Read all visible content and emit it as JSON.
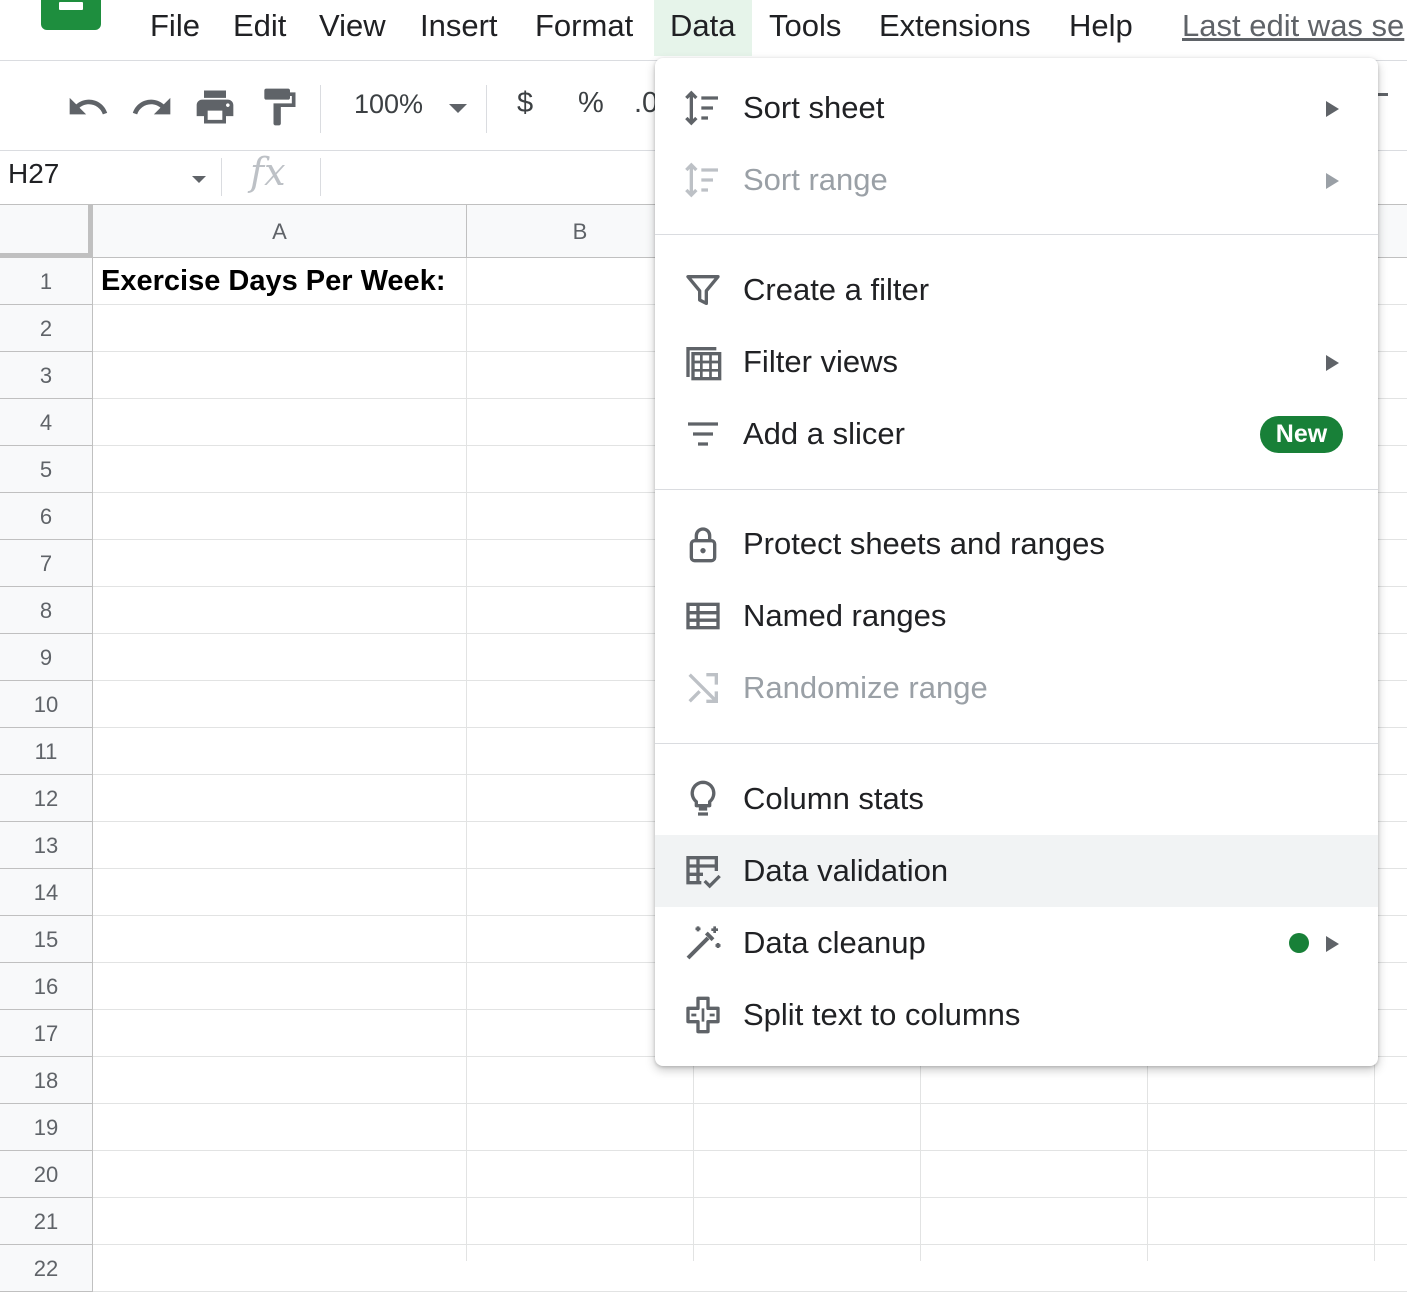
{
  "menubar": {
    "items": [
      "File",
      "Edit",
      "View",
      "Insert",
      "Format",
      "Data",
      "Tools",
      "Extensions",
      "Help"
    ],
    "active": "Data",
    "last_edit": "Last edit was se"
  },
  "toolbar": {
    "zoom": "100%",
    "currency": "$",
    "percent": "%",
    "decimal": ".0"
  },
  "formula_bar": {
    "name_box": "H27",
    "fx": "fx"
  },
  "sheet": {
    "columns": [
      "A",
      "B"
    ],
    "rows": [
      "1",
      "2",
      "3",
      "4",
      "5",
      "6",
      "7",
      "8",
      "9",
      "10",
      "11",
      "12",
      "13",
      "14",
      "15",
      "16",
      "17",
      "18",
      "19",
      "20",
      "21",
      "22"
    ],
    "cell_a1": "Exercise Days Per Week:"
  },
  "data_menu": {
    "items": [
      {
        "label": "Sort sheet",
        "icon": "sort-icon",
        "submenu": true,
        "disabled": false
      },
      {
        "label": "Sort range",
        "icon": "sort-icon",
        "submenu": true,
        "disabled": true
      },
      {
        "label": "Create a filter",
        "icon": "filter-icon",
        "submenu": false,
        "disabled": false
      },
      {
        "label": "Filter views",
        "icon": "filter-views-icon",
        "submenu": true,
        "disabled": false
      },
      {
        "label": "Add a slicer",
        "icon": "slicer-icon",
        "submenu": false,
        "disabled": false,
        "badge": "New"
      },
      {
        "label": "Protect sheets and ranges",
        "icon": "lock-icon",
        "submenu": false,
        "disabled": false
      },
      {
        "label": "Named ranges",
        "icon": "named-ranges-icon",
        "submenu": false,
        "disabled": false
      },
      {
        "label": "Randomize range",
        "icon": "shuffle-icon",
        "submenu": false,
        "disabled": true
      },
      {
        "label": "Column stats",
        "icon": "lightbulb-icon",
        "submenu": false,
        "disabled": false
      },
      {
        "label": "Data validation",
        "icon": "data-validation-icon",
        "submenu": false,
        "disabled": false,
        "highlighted": true
      },
      {
        "label": "Data cleanup",
        "icon": "magic-wand-icon",
        "submenu": true,
        "disabled": false,
        "dot": true
      },
      {
        "label": "Split text to columns",
        "icon": "split-columns-icon",
        "submenu": false,
        "disabled": false
      }
    ]
  },
  "colors": {
    "brand_green": "#188038",
    "active_menu_bg": "#e6f4ea",
    "hover_bg": "#f1f3f4"
  }
}
